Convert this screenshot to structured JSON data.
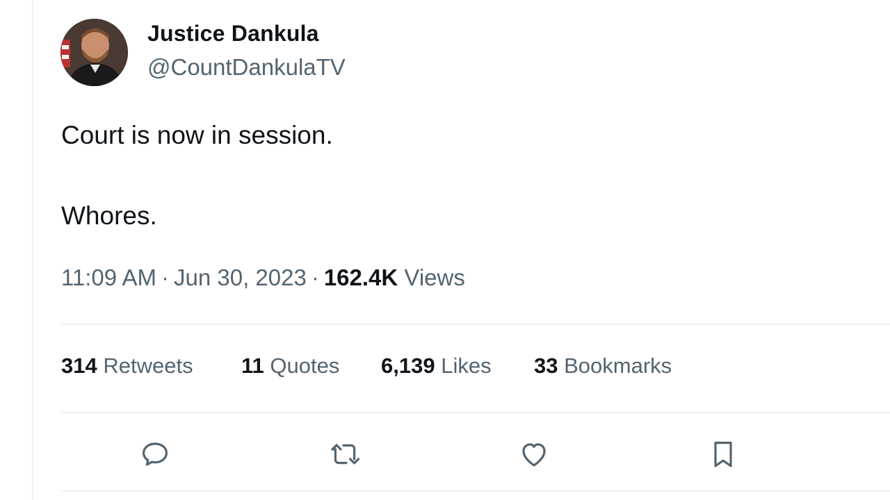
{
  "author": {
    "name": "Justice Dankula",
    "handle": "@CountDankulaTV"
  },
  "tweet": {
    "lines": [
      "Court is now in session.",
      "Whores."
    ],
    "time": "11:09 AM",
    "separator": "·",
    "date": "Jun 30, 2023",
    "views_count": "162.4K",
    "views_label": "Views"
  },
  "stats": {
    "retweets": {
      "count": "314",
      "label": "Retweets"
    },
    "quotes": {
      "count": "11",
      "label": "Quotes"
    },
    "likes": {
      "count": "6,139",
      "label": "Likes"
    },
    "bookmarks": {
      "count": "33",
      "label": "Bookmarks"
    }
  },
  "actions": [
    {
      "name": "reply",
      "icon": "reply-icon"
    },
    {
      "name": "retweet",
      "icon": "retweet-icon"
    },
    {
      "name": "like",
      "icon": "heart-icon"
    },
    {
      "name": "bookmark",
      "icon": "bookmark-icon"
    }
  ],
  "colors": {
    "text_primary": "#0f1419",
    "text_secondary": "#536471",
    "divider": "#eff3f4"
  }
}
